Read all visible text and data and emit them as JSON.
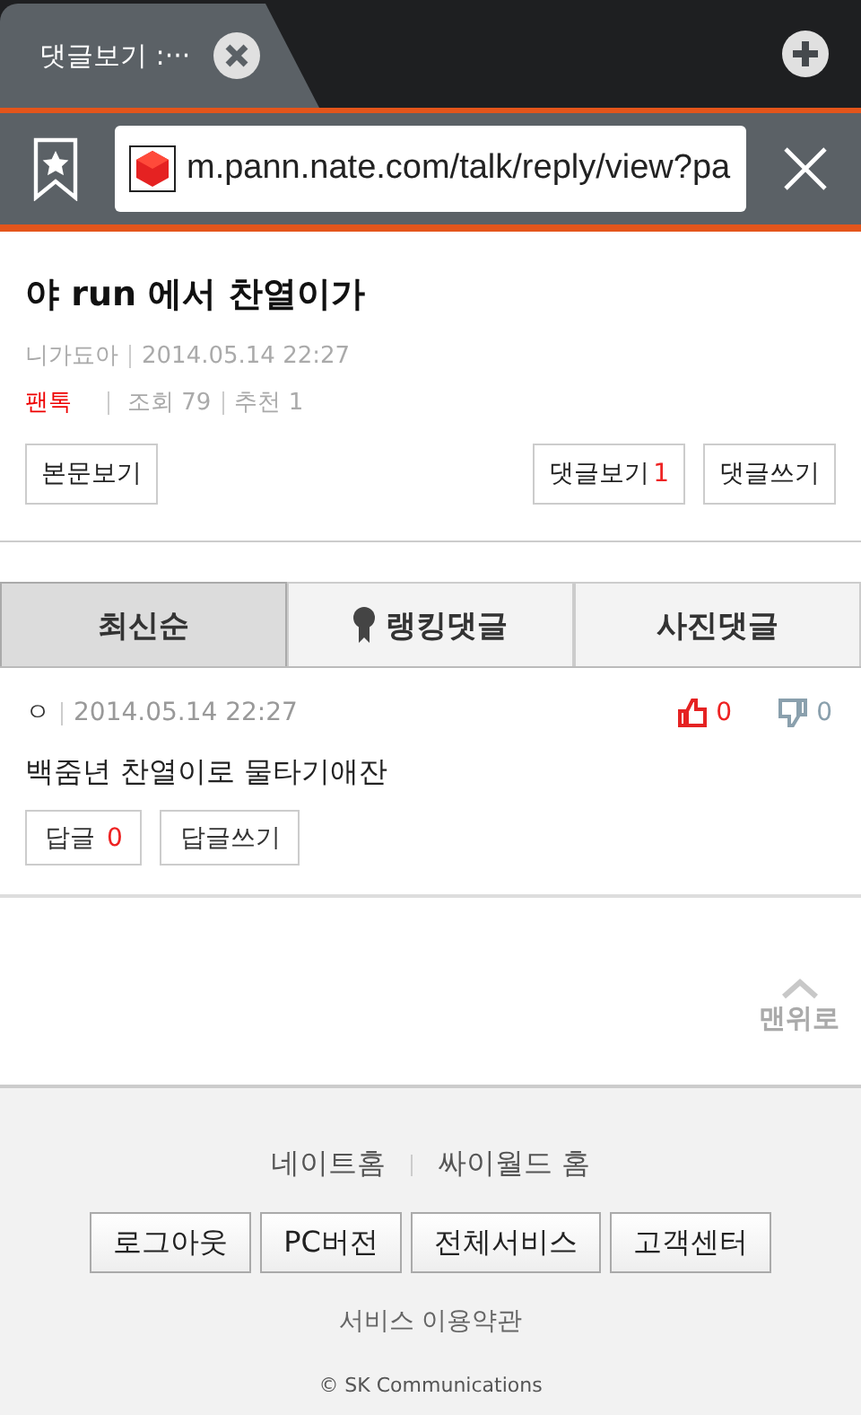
{
  "browser": {
    "tabs": [
      {
        "title": "댓글보기 :···",
        "selected": true
      }
    ],
    "address": "m.pann.nate.com/talk/reply/view?pa"
  },
  "post": {
    "title": "야 run 에서 찬열이가",
    "author": "니가됴아",
    "date": "2014.05.14 22:27",
    "board": "팬톡",
    "views": "조회 79",
    "recommends": "추천 1",
    "buttons": [
      {
        "label": "본문보기"
      },
      {
        "label": "댓글보기",
        "count": "1"
      },
      {
        "label": "댓글쓰기"
      }
    ]
  },
  "sort_tabs": [
    {
      "label": "최신순",
      "selected": true,
      "kind": "plain"
    },
    {
      "label": "랭킹댓글",
      "selected": false,
      "kind": "medal"
    },
    {
      "label": "사진댓글",
      "selected": false,
      "kind": "plain"
    }
  ],
  "comments": [
    {
      "author": "ㅇ",
      "date": "2014.05.14 22:27",
      "likes": "0",
      "dislikes": "0",
      "text": "백줌년 찬열이로 물타기애잔",
      "reply_label": "답글",
      "reply_count": "0",
      "write_reply": "답글쓰기"
    }
  ],
  "top_link": "맨위로",
  "footer": {
    "links": [
      "네이트홈",
      "싸이월드 홈"
    ],
    "buttons": [
      "로그아웃",
      "PC버전",
      "전체서비스",
      "고객센터"
    ],
    "terms": "서비스 이용약관",
    "copyright": "© SK Communications"
  }
}
